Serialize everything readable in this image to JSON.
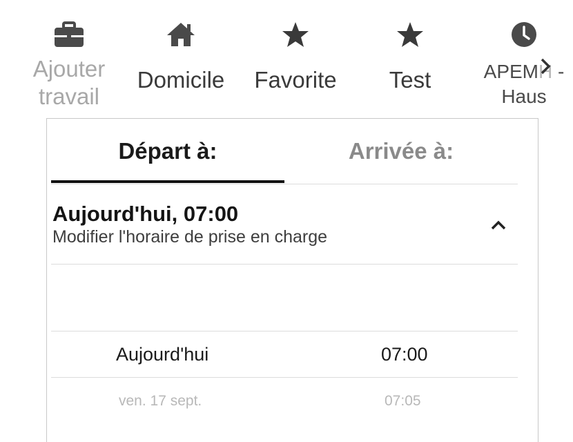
{
  "shortcuts": [
    {
      "label": "Ajouter\ntravail",
      "icon": "briefcase-icon"
    },
    {
      "label": "Domicile",
      "icon": "home-icon"
    },
    {
      "label": "Favorite",
      "icon": "star-icon"
    },
    {
      "label": "Test",
      "icon": "star-icon"
    },
    {
      "label": "APEMH -\nHaus",
      "icon": "clock-icon"
    }
  ],
  "scroll_arrow_icon": "chevron-right-icon",
  "tabs": {
    "depart": "Départ à:",
    "arrivee": "Arrivée à:"
  },
  "date_header": {
    "title": "Aujourd'hui, 07:00",
    "subtitle": "Modifier l'horaire de prise en charge",
    "toggle_icon": "chevron-up-icon"
  },
  "picker": {
    "rows": [
      {
        "day": "Aujourd'hui",
        "time": "07:00"
      },
      {
        "day": "ven. 17 sept.",
        "time": "07:05"
      }
    ]
  },
  "colors": {
    "text_primary": "#1a1a1a",
    "text_muted": "#a8a8a8",
    "divider": "#dcdcdc",
    "icon": "#4a4a4a"
  }
}
